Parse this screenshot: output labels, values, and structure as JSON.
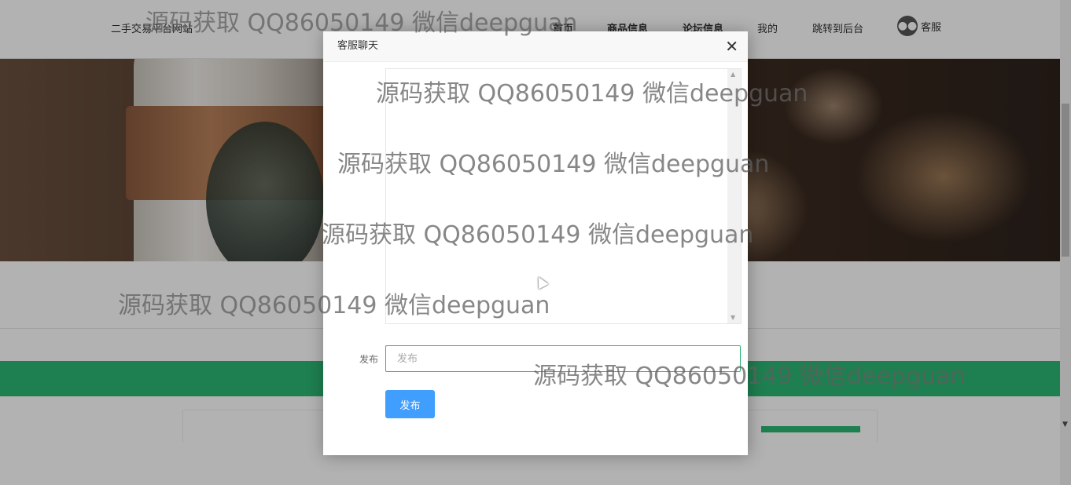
{
  "header": {
    "brand": "二手交易平台网站",
    "nav": [
      {
        "label": "首页"
      },
      {
        "label": "商品信息"
      },
      {
        "label": "论坛信息"
      },
      {
        "label": "我的"
      },
      {
        "label": "跳转到后台"
      }
    ],
    "service_label": "客服",
    "service_icon": "wechat-icon"
  },
  "modal": {
    "title": "客服聊天",
    "close_icon": "close-icon",
    "form_label": "发布",
    "input_placeholder": "发布",
    "input_value": "",
    "submit_label": "发布"
  },
  "watermark": {
    "text": "源码获取 QQ86050149 微信deepguan"
  },
  "colors": {
    "accent_green": "#2bb673",
    "button_blue": "#409eff"
  }
}
